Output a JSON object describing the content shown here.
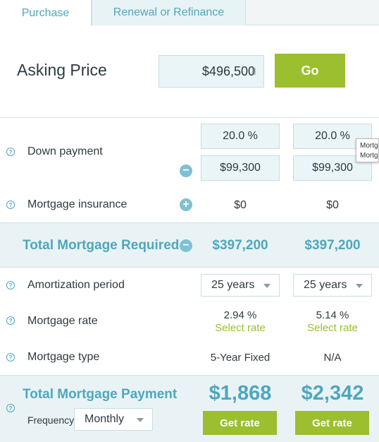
{
  "tabs": [
    {
      "label": "Purchase",
      "active": true
    },
    {
      "label": "Renewal or Refinance",
      "active": false
    }
  ],
  "asking": {
    "label": "Asking Price",
    "value": "$496,500",
    "go_label": "Go"
  },
  "help_glyph": "?",
  "rows": {
    "down_payment": {
      "label": "Down payment",
      "col1_pct": "20.0 %",
      "col2_pct": "20.0 %",
      "col1_amt": "$99,300",
      "col2_amt": "$99,300",
      "toggle_glyph": "−"
    },
    "insurance": {
      "label": "Mortgage insurance",
      "col1": "$0",
      "col2": "$0",
      "toggle_glyph": "+"
    },
    "total_required": {
      "label": "Total Mortgage Required",
      "col1": "$397,200",
      "col2": "$397,200",
      "toggle_glyph": "−"
    },
    "amortization": {
      "label": "Amortization period",
      "col1": "25 years",
      "col2": "25 years"
    },
    "rate": {
      "label": "Mortgage rate",
      "col1": "2.94 %",
      "col2": "5.14 %",
      "select_label": "Select rate"
    },
    "type": {
      "label": "Mortgage type",
      "col1": "5-Year Fixed",
      "col2": "N/A"
    },
    "payment": {
      "label": "Total Mortgage Payment",
      "frequency_label": "Frequency",
      "frequency_value": "Monthly",
      "col1": "$1,868",
      "col2": "$2,342",
      "get_rate_label": "Get rate"
    }
  },
  "tooltip": {
    "line1": "Mortgage",
    "line2": "Mortgage"
  },
  "colors": {
    "accent": "#4ea7bd",
    "green": "#9bbf2f",
    "band": "#e9f3f6"
  }
}
